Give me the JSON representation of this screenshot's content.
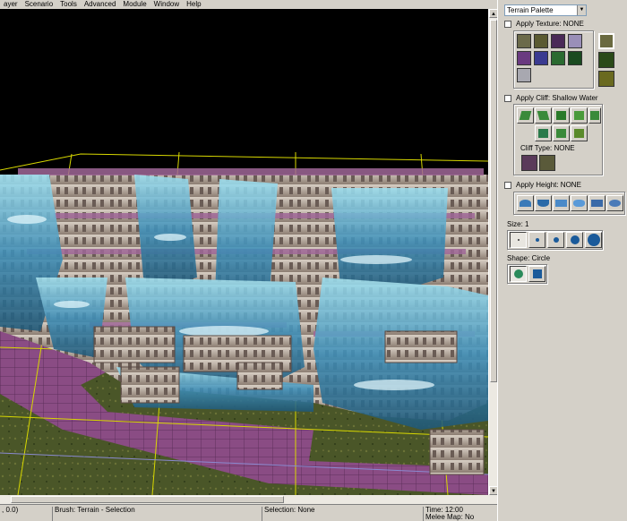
{
  "menu": [
    "ayer",
    "Scenario",
    "Tools",
    "Advanced",
    "Module",
    "Window",
    "Help"
  ],
  "status": {
    "coords": ", 0.0)",
    "brush": "Brush: Terrain - Selection",
    "selection": "Selection: None",
    "time": "Time: 12:00",
    "melee": "Melee Map: No"
  },
  "panel": {
    "palette_select": "Terrain Palette",
    "apply_texture": "Apply Texture: NONE",
    "apply_cliff": "Apply Cliff: Shallow Water",
    "cliff_type": "Cliff Type: NONE",
    "apply_height": "Apply Height: NONE",
    "size": "Size: 1",
    "shape": "Shape: Circle"
  },
  "colors": {
    "water": "#3f8fb8",
    "cliff_stone": "#b7a79b",
    "ground_purple": "#8e4f86",
    "grass": "#4e5a2a",
    "grid_yellow": "#d8d800",
    "selected_texture_border": "#ffffff"
  },
  "icons": {
    "texture_tiles": 12,
    "cliff_tools": 9,
    "height_tools": 6
  }
}
